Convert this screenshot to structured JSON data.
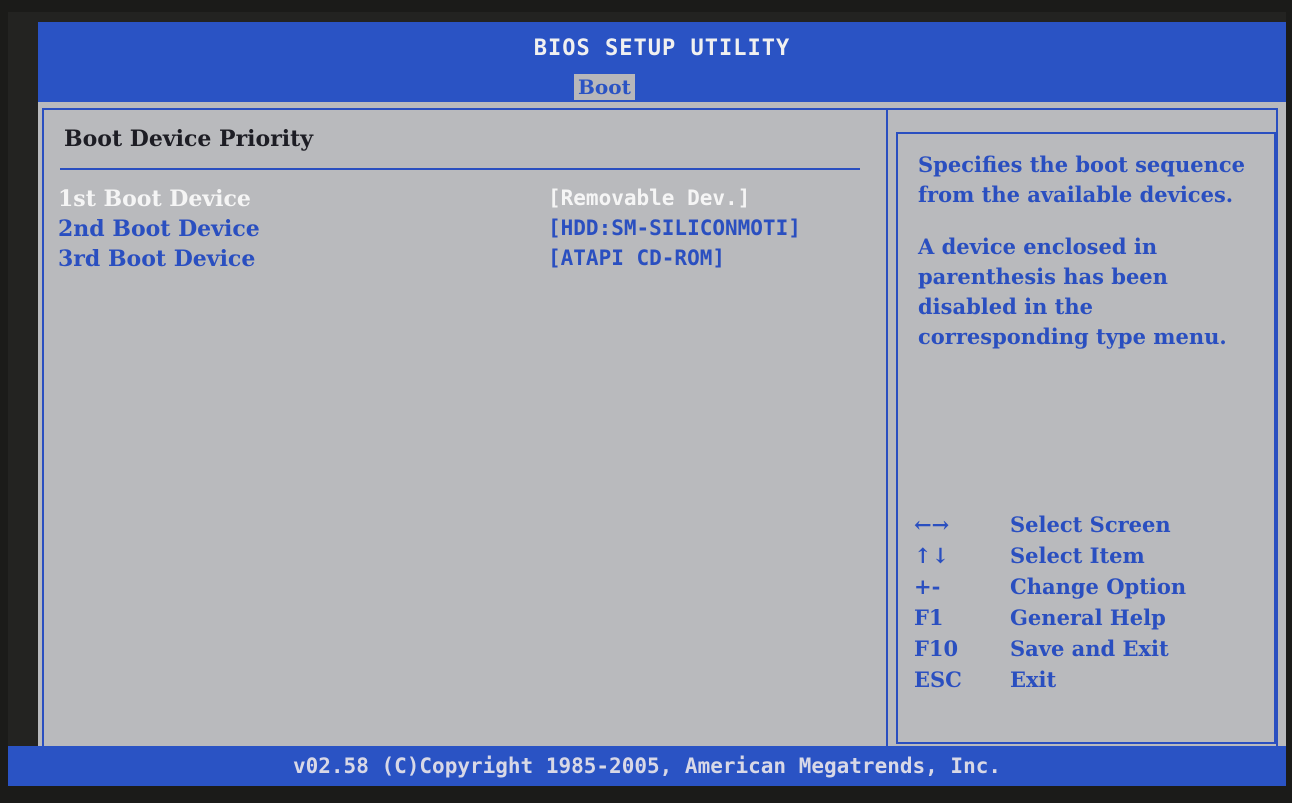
{
  "header": {
    "title": "BIOS SETUP UTILITY",
    "active_tab": "Boot"
  },
  "main": {
    "section_title": "Boot Device Priority",
    "items": [
      {
        "label": "1st Boot Device",
        "value": "[Removable Dev.]",
        "selected": true
      },
      {
        "label": "2nd Boot Device",
        "value": "[HDD:SM-SILICONMOTI]",
        "selected": false
      },
      {
        "label": "3rd Boot Device",
        "value": "[ATAPI CD-ROM]",
        "selected": false
      }
    ]
  },
  "help": {
    "paragraph1": "Specifies the boot sequence from the available devices.",
    "paragraph2": "A device enclosed in parenthesis has been disabled in the corresponding type menu."
  },
  "keys": [
    {
      "key": "←→",
      "action": "Select Screen"
    },
    {
      "key": "↑↓",
      "action": "Select Item"
    },
    {
      "key": "+-",
      "action": "Change Option"
    },
    {
      "key": "F1",
      "action": "General Help"
    },
    {
      "key": "F10",
      "action": "Save and Exit"
    },
    {
      "key": "ESC",
      "action": "Exit"
    }
  ],
  "footer": {
    "copyright": "v02.58 (C)Copyright 1985-2005, American Megatrends, Inc."
  },
  "colors": {
    "bios_blue": "#2a53c4",
    "panel_gray": "#b9babd",
    "selected_text": "#f5f5f5"
  }
}
